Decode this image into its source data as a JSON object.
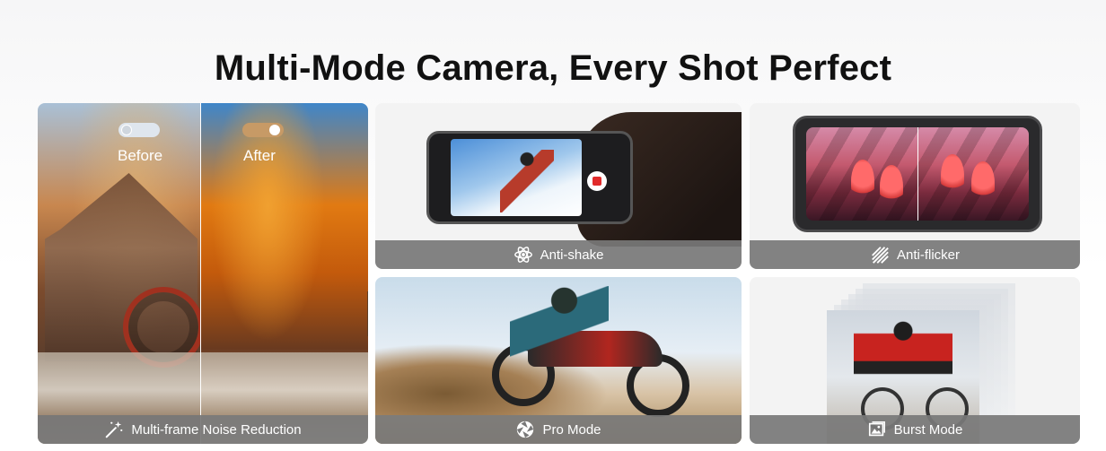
{
  "title": "Multi-Mode Camera, Every Shot Perfect",
  "cards": {
    "noise": {
      "label": "Multi-frame Noise Reduction",
      "before": "Before",
      "after": "After",
      "icon": "magic-wand-icon"
    },
    "shake": {
      "label": "Anti-shake",
      "icon": "atom-stabilizer-icon"
    },
    "flicker": {
      "label": "Anti-flicker",
      "icon": "striped-light-icon"
    },
    "pro": {
      "label": "Pro Mode",
      "icon": "aperture-icon"
    },
    "burst": {
      "label": "Burst Mode",
      "icon": "image-stack-icon"
    }
  },
  "colors": {
    "label_bar": "#787878",
    "title": "#111111",
    "record": "#e12b2b"
  }
}
